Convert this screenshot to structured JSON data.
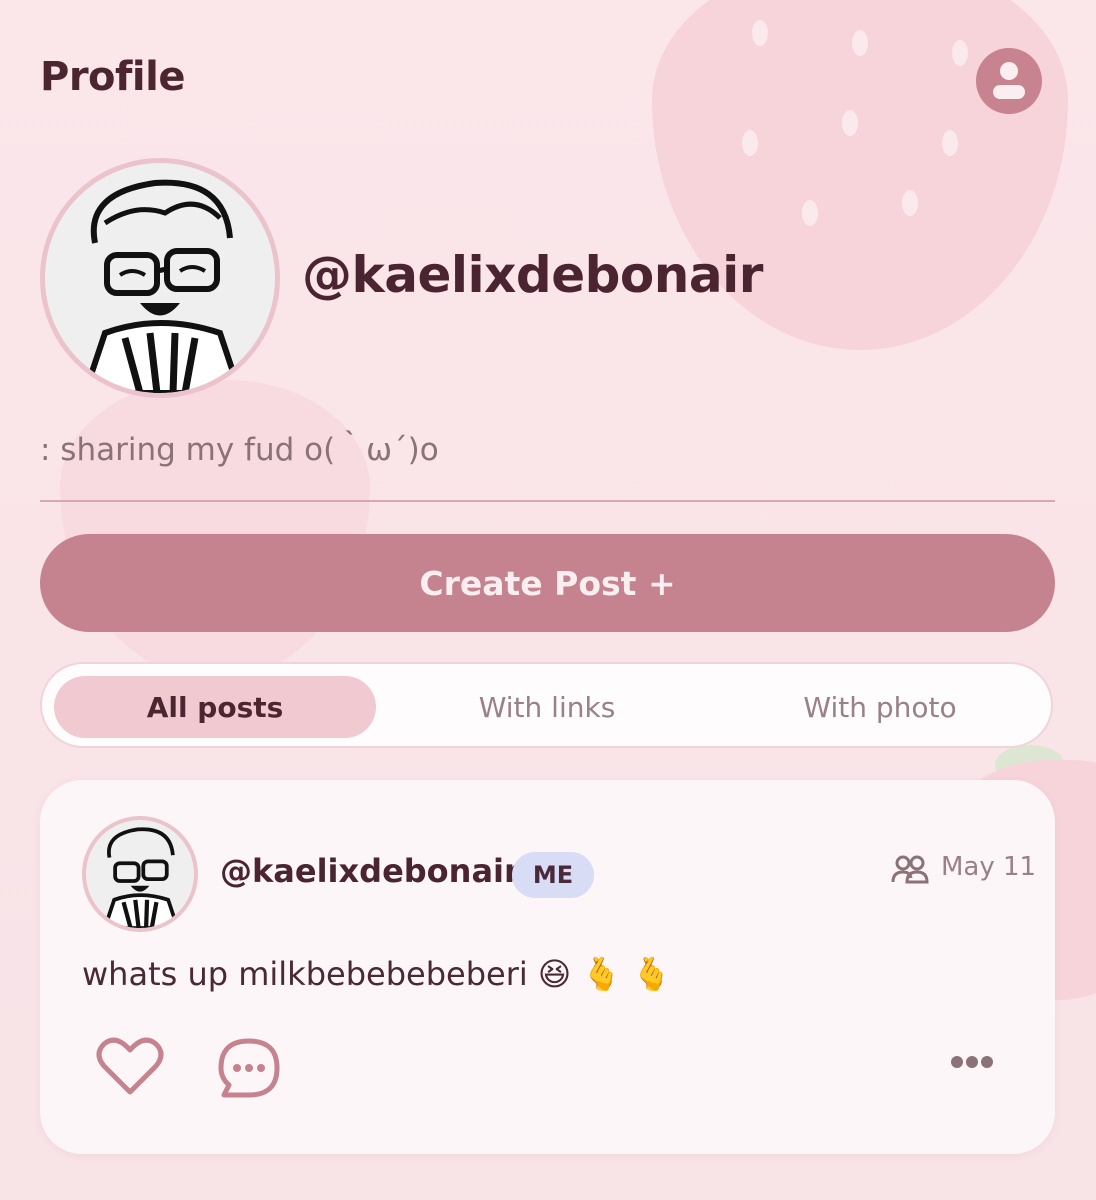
{
  "header": {
    "title": "Profile",
    "account_icon": "account-circle-icon"
  },
  "profile": {
    "username": "@kaelixdebonair",
    "bio": ": sharing my fud o(｀ω´)o",
    "avatar_icon": "avatar-illustration"
  },
  "actions": {
    "create_post_label": "Create Post +"
  },
  "tabs": [
    {
      "label": "All posts",
      "active": true
    },
    {
      "label": "With links",
      "active": false
    },
    {
      "label": "With photo",
      "active": false
    }
  ],
  "post": {
    "username": "@kaelixdebonair",
    "badge": "ME",
    "audience_icon": "friends-icon",
    "date": "May 11",
    "text": "whats up milkbebebebeberi 😆 🫰 🫰",
    "like_icon": "heart-icon",
    "comment_icon": "comment-bubble-icon",
    "more_icon": "more-dots-icon"
  },
  "colors": {
    "accent": "#c4838e",
    "background": "#fae9ec",
    "tab_active": "#f1c9d1",
    "badge": "#d9dcf5",
    "text_dark": "#4a2531"
  }
}
